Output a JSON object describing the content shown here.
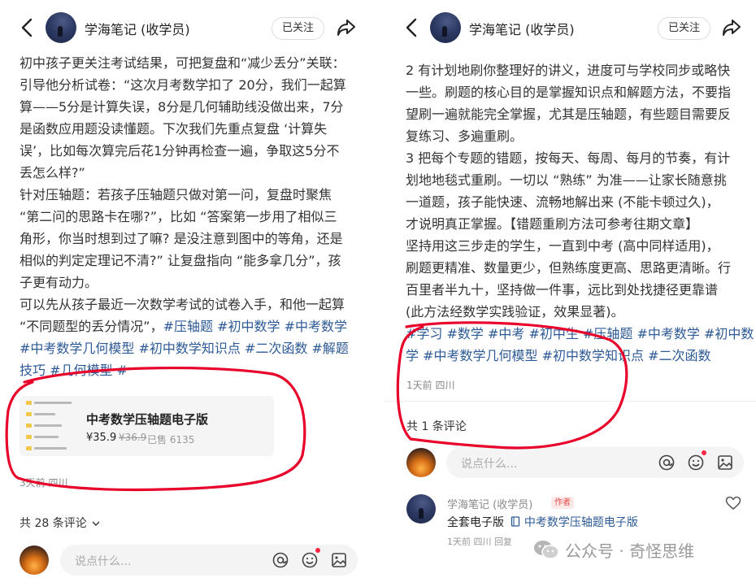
{
  "left_panel": {
    "header": {
      "author": "学海笔记 (收学员)",
      "follow_label": "已关注"
    },
    "body_lines": [
      "初中孩子更关注考试结果，可把复盘和“减少丢分”关联：",
      "引导他分析试卷：“这次月考数学扣了 20分，我们一起算",
      "算——5分是计算失误，8分是几何辅助线没做出来，7分",
      "是函数应用题没读懂题。下次我们先重点复盘 ‘计算失",
      "误’，比如每次算完后花1分钟再检查一遍，争取这5分不",
      "丢怎么样?”",
      "针对压轴题：若孩子压轴题只做对第一问，复盘时聚焦",
      "“第二问的思路卡在哪?”，比如 “答案第一步用了相似三",
      "角形，你当时想到过了嘛? 是没注意到图中的等角，还是",
      "相似的判定定理记不清?” 让复盘指向 “能多拿几分”，孩",
      "子更有动力。",
      "可以先从孩子最近一次数学考试的试卷入手，和他一起算",
      "“不同题型的丢分情况”，"
    ],
    "tags_line1": "#压轴题 #初中数学 #中考数学",
    "tags_line2": "#中考数学几何模型 #初中数学知识点 #二次函数 #解题",
    "tags_line3": "技巧 #几何模型 #",
    "product": {
      "title": "中考数学压轴题电子版",
      "price": "¥35.9",
      "old_price": "¥36.9",
      "sold": "已售 6135"
    },
    "meta": "3天前 四川",
    "comment_count": "共 28 条评论",
    "comment_placeholder": "说点什么..."
  },
  "right_panel": {
    "header": {
      "author": "学海笔记 (收学员)",
      "follow_label": "已关注"
    },
    "body_lines": [
      "2 有计划地刷你整理好的讲义，进度可与学校同步或略快",
      "一些。刷题的核心目的是掌握知识点和解题方法，不要指",
      "望刷一遍就能完全掌握，尤其是压轴题，有些题目需要反",
      "复练习、多遍重刷。",
      "3 把每个专题的错题，按每天、每周、每月的节奏，有计",
      "划地地毯式重刷。一切以 “熟练” 为准——让家长随意挑",
      "一道题，孩子能快速、流畅地解出来 (不能卡顿过久)，",
      "才说明真正掌握。【错题重刷方法可参考往期文章】",
      "坚持用这三步走的学生，一直到中考 (高中同样适用)，",
      "刷题更精准、数量更少，但熟练度更高、思路更清晰。行",
      "百里者半九十，坚持做一件事，远比到处找捷径更靠谱",
      "(此方法经数学实践验证，效果显著)。"
    ],
    "tags_line1": "#学习 #数学 #中考 #初中生 #压轴题 #中考数学 #初中数",
    "tags_line2": "学 #中考数学几何模型 #初中数学知识点 #二次函数",
    "meta": "1天前 四川",
    "comment_count": "共 1 条评论",
    "comment_placeholder": "说点什么...",
    "reply": {
      "name": "学海笔记 (收学员)",
      "badge": "作者",
      "text": "全套电子版",
      "link": "中考数学压轴题电子版",
      "meta": "1天前 四川 回复"
    }
  },
  "watermark": "公众号 · 奇怪思维",
  "colors": {
    "tag": "#2d5a96",
    "annotation": "#e8002a",
    "notify": "#ff2442"
  },
  "icons": [
    "back-arrow-icon",
    "share-icon",
    "at-icon",
    "emoji-icon",
    "image-icon",
    "heart-icon",
    "chevron-down-icon",
    "book-icon",
    "wechat-icon"
  ]
}
